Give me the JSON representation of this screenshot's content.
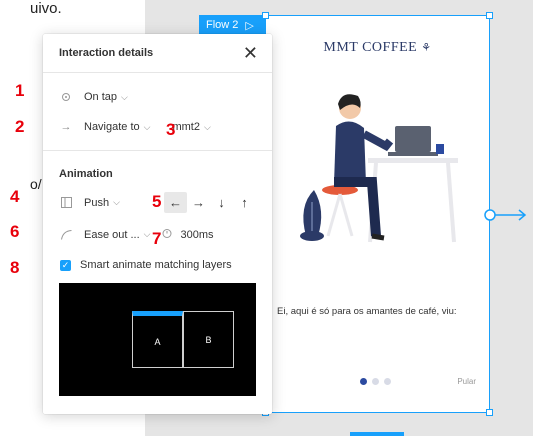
{
  "background": {
    "doc_text_top": "uivo.",
    "doc_text_mid": "o/"
  },
  "flow": {
    "label": "Flow 2",
    "play_icon": "play-icon"
  },
  "frame": {
    "brand": "MMT COFFEE",
    "caption": "Ei, aqui é só para os amantes de café, viu:",
    "skip": "Pular",
    "dots": 3,
    "active_dot": 0
  },
  "panel": {
    "title": "Interaction details",
    "trigger": "On tap",
    "action": "Navigate to",
    "destination": "mmt2",
    "animation_title": "Animation",
    "transition": "Push",
    "directions": [
      "←",
      "→",
      "↓",
      "↑"
    ],
    "selected_direction": 0,
    "easing": "Ease out ...",
    "duration": "300ms",
    "smart_animate_label": "Smart animate matching layers",
    "smart_animate_checked": true,
    "preview": {
      "box_a": "A",
      "box_b": "B"
    }
  },
  "annotations": [
    "1",
    "2",
    "3",
    "4",
    "5",
    "6",
    "7",
    "8"
  ],
  "colors": {
    "accent": "#18a0fb",
    "annotation": "#e8000b",
    "brand": "#2b3a67"
  }
}
